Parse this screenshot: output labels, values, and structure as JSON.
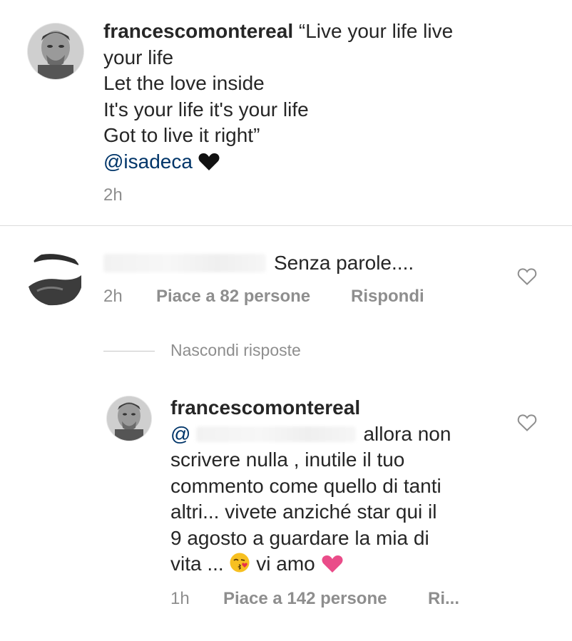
{
  "caption": {
    "username": "francescomontereal",
    "lines": [
      "“Live your life live",
      "your life",
      "Let the love inside",
      "It's your life it's your life",
      "Got to live it right”"
    ],
    "mention": "@isadeca",
    "emoji": "black-heart",
    "time": "2h"
  },
  "comment": {
    "username_hidden": true,
    "text": "Senza parole....",
    "time": "2h",
    "likes": "Piace a 82 persone",
    "reply_label": "Rispondi"
  },
  "replies_toggle": {
    "label": "Nascondi risposte"
  },
  "reply": {
    "username": "francescomontereal",
    "mention_prefix": "@",
    "text_line1": "allora non",
    "lines": [
      "scrivere nulla , inutile il tuo",
      "commento come quello di tanti",
      "altri... vivete anziché star qui il",
      "9 agosto a guardare la mia di"
    ],
    "last_line_start": "vita ...",
    "last_line_end": "vi amo",
    "time": "1h",
    "likes": "Piace a 142 persone",
    "reply_label": "Ri..."
  },
  "colors": {
    "text": "#262626",
    "meta": "#8e8e8e",
    "mention": "#003569",
    "divider": "#dbdbdb",
    "pink_heart": "#ea4c89"
  }
}
